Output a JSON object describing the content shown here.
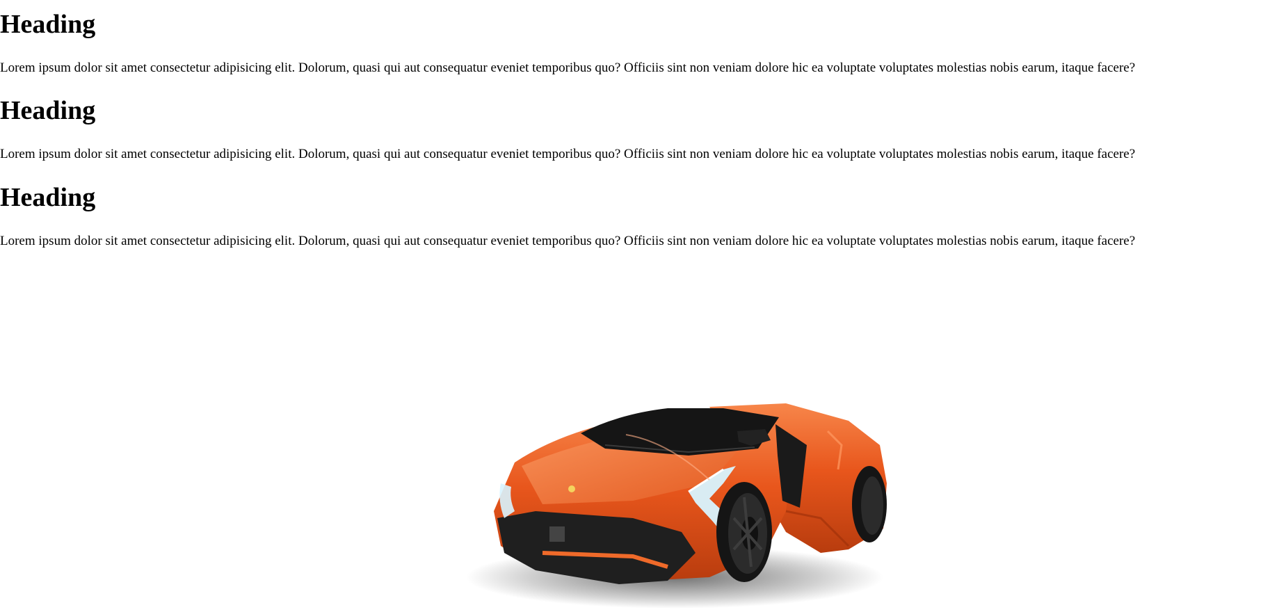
{
  "sections": [
    {
      "heading": "Heading",
      "paragraph": "Lorem ipsum dolor sit amet consectetur adipisicing elit. Dolorum, quasi qui aut consequatur eveniet temporibus quo? Officiis sint non veniam dolore hic ea voluptate voluptates molestias nobis earum, itaque facere?"
    },
    {
      "heading": "Heading",
      "paragraph": "Lorem ipsum dolor sit amet consectetur adipisicing elit. Dolorum, quasi qui aut consequatur eveniet temporibus quo? Officiis sint non veniam dolore hic ea voluptate voluptates molestias nobis earum, itaque facere?"
    },
    {
      "heading": "Heading",
      "paragraph": "Lorem ipsum dolor sit amet consectetur adipisicing elit. Dolorum, quasi qui aut consequatur eveniet temporibus quo? Officiis sint non veniam dolore hic ea voluptate voluptates molestias nobis earum, itaque facere?"
    }
  ],
  "image": {
    "subject": "orange sports car",
    "colors": {
      "body": "#e8561c",
      "body_highlight": "#f5793a",
      "dark": "#1a1a1a",
      "headlight": "#d8f4ff"
    }
  }
}
